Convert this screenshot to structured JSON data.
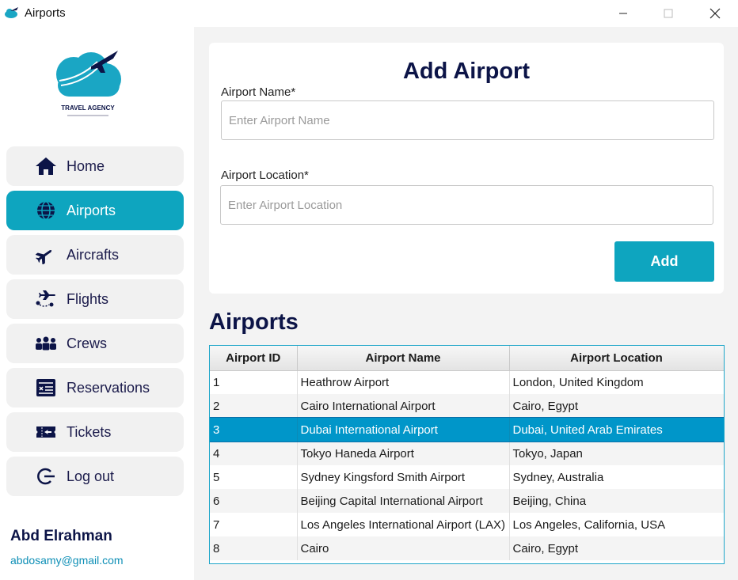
{
  "window": {
    "title": "Airports"
  },
  "sidebar": {
    "logo_text": "TRAVEL AGENCY",
    "items": [
      {
        "label": "Home",
        "icon": "home-icon",
        "active": false
      },
      {
        "label": "Airports",
        "icon": "globe-icon",
        "active": true
      },
      {
        "label": "Aircrafts",
        "icon": "airplane-icon",
        "active": false
      },
      {
        "label": "Flights",
        "icon": "flight-route-icon",
        "active": false
      },
      {
        "label": "Crews",
        "icon": "crew-icon",
        "active": false
      },
      {
        "label": "Reservations",
        "icon": "reservation-card-icon",
        "active": false
      },
      {
        "label": "Tickets",
        "icon": "ticket-icon",
        "active": false
      },
      {
        "label": "Log out",
        "icon": "logout-icon",
        "active": false
      }
    ],
    "user": {
      "name": "Abd Elrahman",
      "email": "abdosamy@gmail.com"
    }
  },
  "form": {
    "title": "Add Airport",
    "name_label": "Airport Name*",
    "name_placeholder": "Enter Airport Name",
    "location_label": "Airport Location*",
    "location_placeholder": "Enter Airport Location",
    "add_button": "Add"
  },
  "table": {
    "title": "Airports",
    "columns": [
      "Airport ID",
      "Airport Name",
      "Airport Location"
    ],
    "selected_row": 2,
    "rows": [
      [
        "1",
        "Heathrow Airport",
        "London, United Kingdom"
      ],
      [
        "2",
        "Cairo International Airport",
        "Cairo, Egypt"
      ],
      [
        "3",
        "Dubai International Airport",
        "Dubai, United Arab Emirates"
      ],
      [
        "4",
        "Tokyo Haneda Airport",
        "Tokyo, Japan"
      ],
      [
        "5",
        "Sydney Kingsford Smith Airport",
        "Sydney, Australia"
      ],
      [
        "6",
        "Beijing Capital International Airport",
        "Beijing, China"
      ],
      [
        "7",
        "Los Angeles International Airport (LAX)",
        "Los Angeles, California, USA"
      ],
      [
        "8",
        "Cairo",
        "Cairo, Egypt"
      ]
    ]
  },
  "colors": {
    "accent": "#0ea5bf",
    "heading": "#0c1447",
    "selected_row": "#0096c9"
  }
}
